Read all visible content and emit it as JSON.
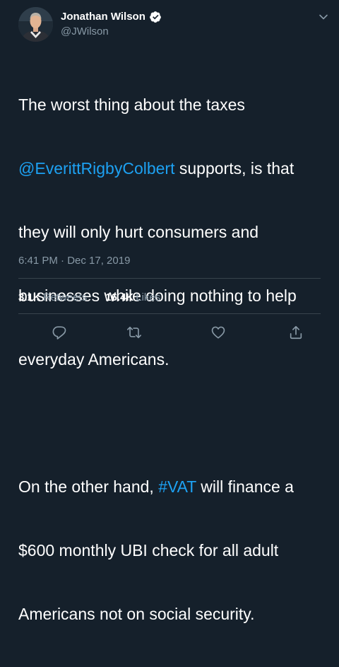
{
  "author": {
    "display_name": "Jonathan Wilson",
    "handle": "@JWilson",
    "verified": true,
    "avatar_icon": "profile-photo"
  },
  "tweet": {
    "line1_prefix": "The worst thing about the taxes",
    "mention": "@EverittRigbyColbert",
    "line2_suffix": " supports, is that",
    "line3": "they will only hurt consumers and",
    "line4": "businesses while doing nothing to help",
    "line5": "everyday Americans.",
    "line6_prefix": "On the other hand, ",
    "hashtag": "#VAT",
    "line6_suffix": " will finance a",
    "line7": "$600 monthly UBI check for all adult",
    "line8": "Americans not on social security."
  },
  "timestamp": "6:41 PM · Dec 17, 2019",
  "stats": {
    "retweets_count": "3.1K",
    "retweets_label": "Retweets",
    "likes_count": "16.4K",
    "likes_label": "Likes"
  },
  "icons": {
    "reply": "reply-icon",
    "retweet": "retweet-icon",
    "like": "heart-icon",
    "share": "share-icon",
    "menu": "chevron-down-icon",
    "verified": "verified-badge-icon"
  },
  "colors": {
    "background": "#15202b",
    "text_primary": "#ffffff",
    "text_secondary": "#8899a6",
    "link": "#1da1f2",
    "divider": "#38444d"
  }
}
